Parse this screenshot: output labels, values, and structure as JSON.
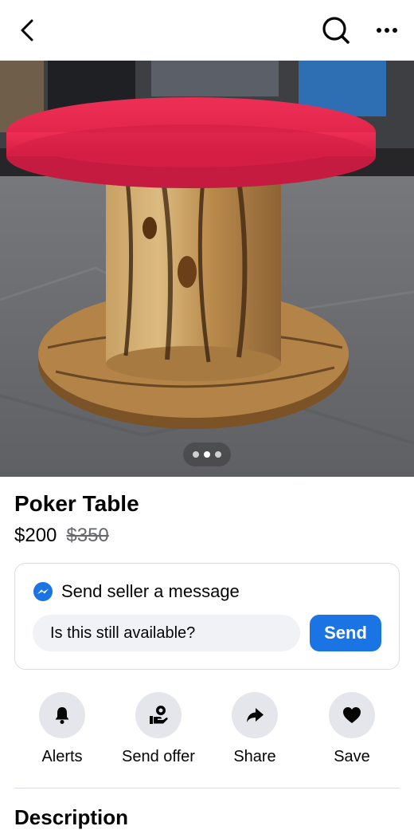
{
  "header": {
    "back_icon": "chevron-left-icon",
    "search_icon": "search-icon",
    "more_icon": "more-horizontal-icon"
  },
  "gallery": {
    "photo_count": 3,
    "active_index": 1
  },
  "listing": {
    "title": "Poker Table",
    "price": "$200",
    "original_price": "$350"
  },
  "message": {
    "heading": "Send seller a message",
    "input_value": "Is this still available?",
    "send_label": "Send",
    "accent_color": "#1b74e4"
  },
  "actions": [
    {
      "label": "Alerts",
      "icon": "bell-icon"
    },
    {
      "label": "Send offer",
      "icon": "offer-hand-icon"
    },
    {
      "label": "Share",
      "icon": "share-arrow-icon"
    },
    {
      "label": "Save",
      "icon": "heart-icon"
    }
  ],
  "section": {
    "description_heading": "Description"
  }
}
